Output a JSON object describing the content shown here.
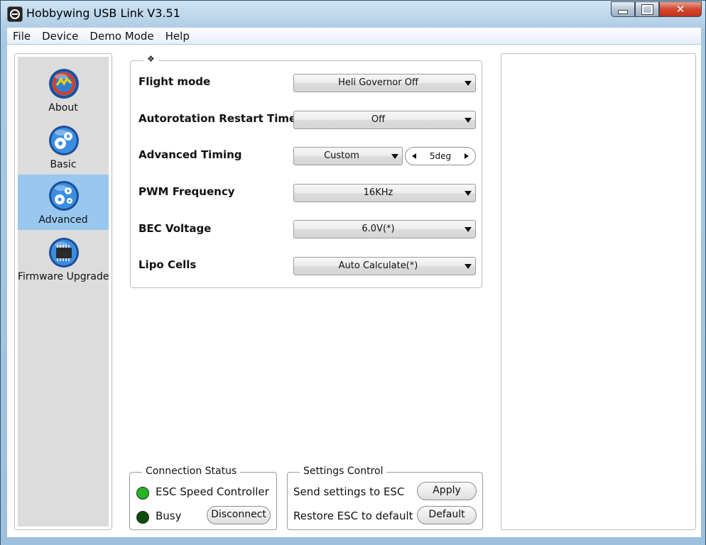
{
  "window": {
    "title": "Hobbywing USB Link V3.51",
    "controls": {
      "minimize": "minimize",
      "maximize": "maximize",
      "close": "✕"
    }
  },
  "menu": [
    "File",
    "Device",
    "Demo Mode",
    "Help"
  ],
  "sidebar": {
    "items": [
      {
        "label": "About",
        "icon": "hw-logo-icon"
      },
      {
        "label": "Basic",
        "icon": "gears-icon"
      },
      {
        "label": "Advanced",
        "icon": "advanced-gears-icon",
        "active": true
      },
      {
        "label": "Firmware Upgrade",
        "icon": "chip-icon"
      }
    ]
  },
  "settings": {
    "group_marker": "❖",
    "rows": [
      {
        "label": "Flight mode",
        "value": "Heli Governor Off"
      },
      {
        "label": "Autorotation Restart Time",
        "value": "Off"
      },
      {
        "label": "Advanced Timing",
        "value": "Custom",
        "spin_value": "5deg"
      },
      {
        "label": "PWM Frequency",
        "value": "16KHz"
      },
      {
        "label": "BEC Voltage",
        "value": "6.0V(*)"
      },
      {
        "label": "Lipo Cells",
        "value": "Auto Calculate(*)"
      }
    ]
  },
  "connection_status": {
    "title": "Connection Status",
    "esc_label": "ESC Speed Controller",
    "busy_label": "Busy",
    "disconnect_button": "Disconnect",
    "esc_led_color": "#22b422",
    "busy_led_color": "#0b4d0b"
  },
  "settings_control": {
    "title": "Settings Control",
    "send_label": "Send settings to ESC",
    "apply_button": "Apply",
    "restore_label": "Restore ESC to default",
    "default_button": "Default"
  },
  "colors": {
    "active_sidebar": "#98c7ef",
    "sidebar_bg": "#dcdcdc"
  }
}
